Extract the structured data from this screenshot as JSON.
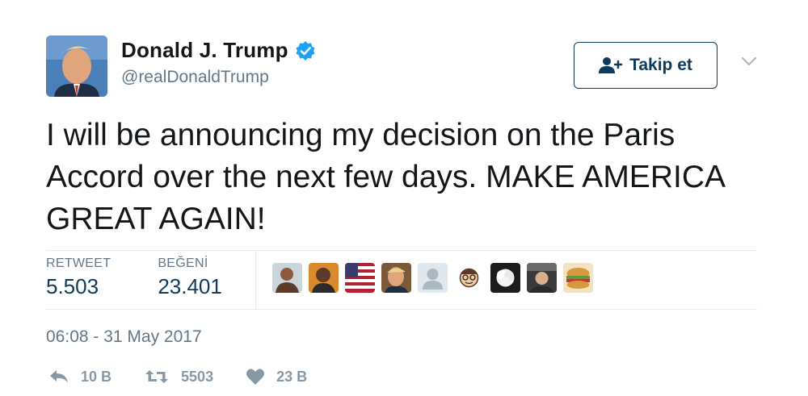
{
  "author": {
    "display_name": "Donald J. Trump",
    "handle": "@realDonaldTrump",
    "verified_icon": "verified-badge-icon"
  },
  "follow_button": {
    "label": "Takip et",
    "icon": "add-user-icon"
  },
  "menu_icon": "chevron-down-icon",
  "tweet": {
    "text": "I will be announcing my decision on the Paris Accord over the next few days. MAKE AMERICA GREAT AGAIN!"
  },
  "stats": {
    "retweet_label": "RETWEET",
    "retweet_value": "5.503",
    "like_label": "BEĞENİ",
    "like_value": "23.401"
  },
  "timestamp": "06:08 - 31 May 2017",
  "actions": {
    "reply_count": "10 B",
    "retweet_count": "5503",
    "like_count": "23 B"
  },
  "colors": {
    "accent": "#1da1f2",
    "dark_blue": "#0e3a5c",
    "muted": "#657786",
    "icon_gray": "#8899a6",
    "divider": "#e6ecf0"
  }
}
